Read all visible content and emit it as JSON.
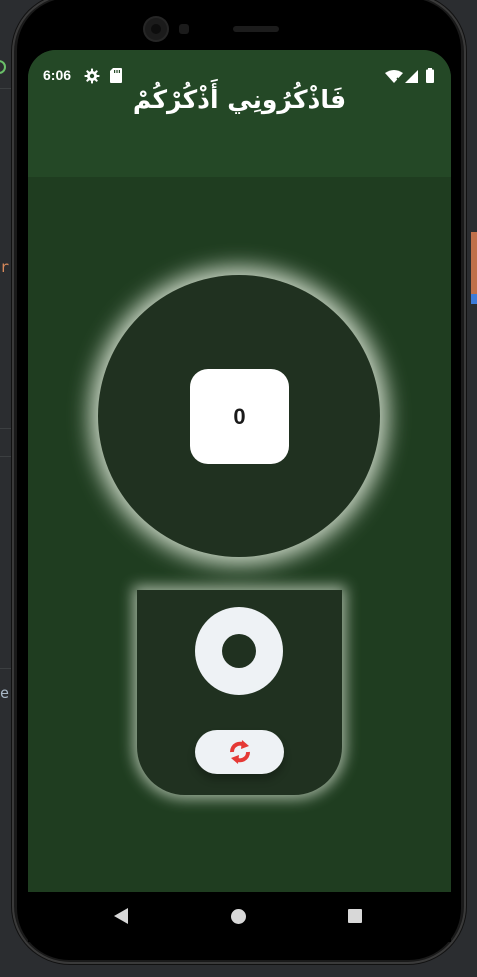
{
  "status_bar": {
    "time": "6:06",
    "icons": [
      "gear-icon",
      "sd-card-icon",
      "wifi-icon",
      "signal-icon",
      "battery-icon"
    ]
  },
  "app_bar": {
    "title": "فَاذْكُرُونِي أَذْكُرْكُمْ"
  },
  "counter": {
    "value": "0"
  },
  "controls": {
    "tap_icon": "circle-ring-icon",
    "reset_icon": "refresh-icon"
  },
  "ide_background": {
    "left_chars": [
      "r",
      "e"
    ]
  },
  "colors": {
    "app_bar": "#244826",
    "body": "#1f3d20",
    "circle": "#203120",
    "glow": "#e6f0e1",
    "accent_red": "#e53935"
  }
}
